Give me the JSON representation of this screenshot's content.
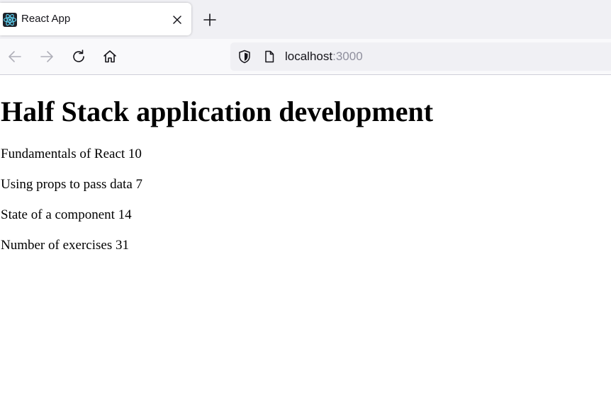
{
  "browser": {
    "tab": {
      "title": "React App",
      "favicon": "react-logo-icon"
    },
    "icons": {
      "close": "close-icon",
      "new_tab": "plus-icon",
      "back": "arrow-left-icon",
      "forward": "arrow-right-icon",
      "reload": "reload-icon",
      "home": "home-icon",
      "shield": "shield-icon",
      "page": "page-icon"
    },
    "url": {
      "host": "localhost",
      "port": ":3000"
    }
  },
  "page": {
    "header": "Half Stack application development",
    "parts": [
      {
        "text": "Fundamentals of React 10"
      },
      {
        "text": "Using props to pass data 7"
      },
      {
        "text": "State of a component 14"
      }
    ],
    "total": "Number of exercises 31"
  },
  "colors": {
    "tabstrip": "#f0f0f4",
    "toolbar": "#f9f9fb",
    "urlbar": "#f0f0f4",
    "react": "#61dafb",
    "text": "#15141a",
    "muted": "#8f8f9d"
  }
}
